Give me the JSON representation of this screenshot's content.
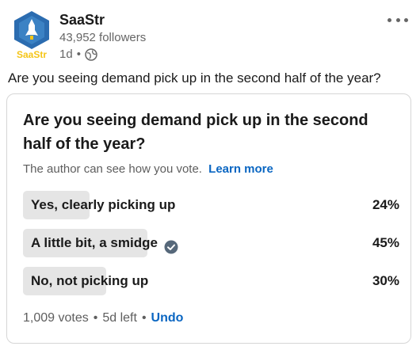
{
  "author": {
    "name": "SaaStr",
    "followers": "43,952 followers",
    "time": "1d",
    "separator": "•",
    "logo_text": "SaaStr"
  },
  "post": {
    "text": "Are you seeing demand pick up in the second half of the year?"
  },
  "poll": {
    "question": "Are you seeing demand pick up in the second half of the year?",
    "visibility_note": "The author can see how you vote.",
    "learn_more": "Learn more",
    "options": [
      {
        "label": "Yes, clearly picking up",
        "percent": "24%",
        "share": 0.24,
        "selected": false
      },
      {
        "label": "A little bit, a smidge",
        "percent": "45%",
        "share": 0.45,
        "selected": true
      },
      {
        "label": "No, not picking up",
        "percent": "30%",
        "share": 0.3,
        "selected": false
      }
    ],
    "votes": "1,009 votes",
    "dot": "•",
    "time_left": "5d left",
    "undo": "Undo"
  },
  "colors": {
    "accent": "#0a66c2",
    "logo_blue": "#2b6cb0",
    "logo_yellow": "#f5c518",
    "bar_fill": "#e5e5e5"
  }
}
